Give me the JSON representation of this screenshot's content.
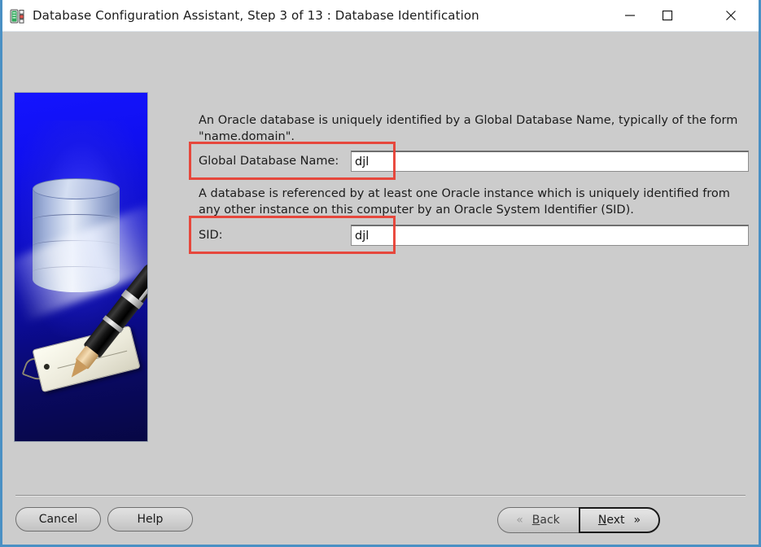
{
  "window": {
    "title": "Database Configuration Assistant, Step 3 of 13 : Database Identification",
    "icon": "database-server-icon",
    "controls": {
      "minimize": "minimize-icon",
      "maximize": "maximize-icon",
      "close": "close-icon"
    },
    "accent_border": "#4a90c4",
    "body_background": "#cccccc",
    "titlebar_background": "#ffffff"
  },
  "sidebar": {
    "image_alt": "Oracle database cylinder with fountain pen and luggage tag on blue gradient",
    "gradient_top": "#1414ff",
    "gradient_bottom": "#070744"
  },
  "main": {
    "paragraph_1": "An Oracle database is uniquely identified by a Global Database Name, typically of the form \"name.domain\".",
    "paragraph_2": "A database is referenced by at least one Oracle instance which is uniquely identified from any other instance on this computer by an Oracle System Identifier (SID).",
    "fields": [
      {
        "id": "global-database-name",
        "label": "Global Database Name:",
        "value": "djl",
        "placeholder": ""
      },
      {
        "id": "sid",
        "label": "SID:",
        "value": "djl",
        "placeholder": ""
      }
    ],
    "annotations": {
      "color": "#e83c30",
      "count": 2
    }
  },
  "footer": {
    "cancel_label": "Cancel",
    "help_label": "Help",
    "back": {
      "label": "Back",
      "mnemonic": "B",
      "chevron": "«",
      "enabled": false
    },
    "next": {
      "label": "Next",
      "mnemonic": "N",
      "chevron": "»",
      "enabled": true,
      "focused": true
    }
  }
}
